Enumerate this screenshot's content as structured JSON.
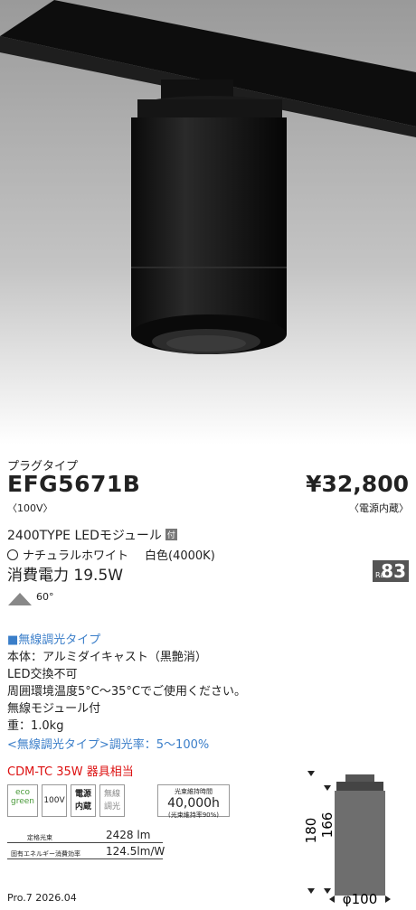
{
  "header": {
    "series": "プラグタイプ",
    "model": "EFG5671B",
    "voltage": "〈100V〉",
    "price": "¥32,800",
    "price_note": "〈電源内蔵〉"
  },
  "module": {
    "label": "2400TYPE LEDモジュール",
    "attach_badge": "付"
  },
  "color": {
    "name": "ナチュラルホワイト",
    "temp": "白色(4000K)"
  },
  "power": "消費電力 19.5W",
  "ra": {
    "label": "Ra",
    "value": "83"
  },
  "beam": "60°",
  "feature_type": "■無線調光タイプ",
  "specs": [
    "本体：アルミダイキャスト（黒艶消）",
    "LED交換不可",
    "周囲環境温度5°C〜35°Cでご使用ください。",
    "無線モジュール付",
    "重：1.0kg"
  ],
  "dimming": "<無線調光タイプ>調光率：5〜100%",
  "equivalent": "CDM-TC 35W 器具相当",
  "icons": {
    "eco_top": "eco",
    "eco_bottom": "green",
    "voltage": "100V",
    "builtin_power": "電源\n内蔵",
    "wireless_dim": "無線\n調光",
    "life_title": "光束維持時間",
    "life_value": "40,000h",
    "life_note": "(光束維持率90%)"
  },
  "rated_flux": {
    "label": "定格光束",
    "value": "2428 lm"
  },
  "efficiency": {
    "label": "固有エネルギー消費効率",
    "value": "124.5lm/W"
  },
  "dimensions": {
    "height_total": "180",
    "height_body": "166",
    "diameter": "φ100"
  },
  "footer": "Pro.7 2026.04",
  "colors": {
    "accent_blue": "#3a7ec9",
    "accent_red": "#d11111",
    "fixture_black": "#111111"
  }
}
